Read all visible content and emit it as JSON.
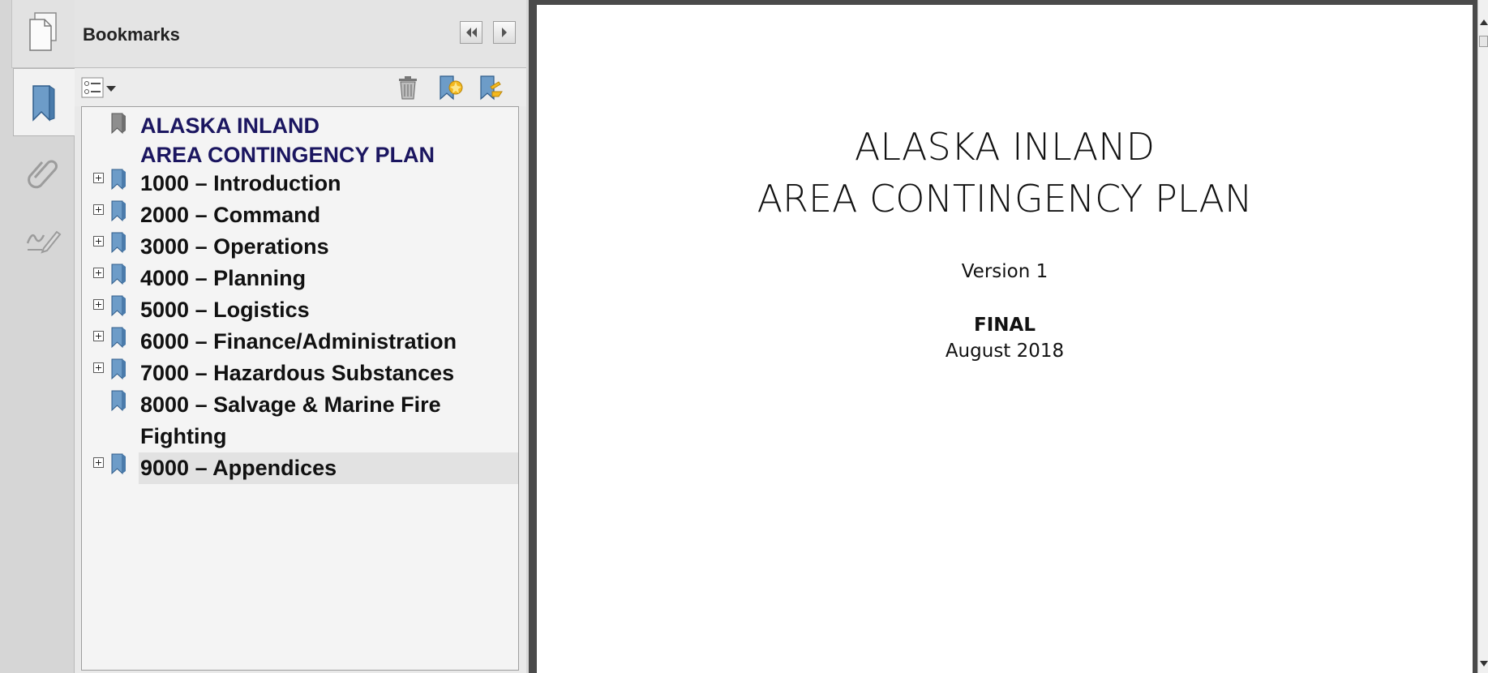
{
  "navigation_rail": {
    "items": [
      {
        "icon": "page-thumbnails-icon"
      },
      {
        "icon": "bookmark-icon",
        "active": true
      },
      {
        "icon": "paperclip-icon"
      },
      {
        "icon": "signature-icon"
      }
    ]
  },
  "bookmarks_panel": {
    "title": "Bookmarks",
    "header_buttons": [
      "collapse-panel-icon",
      "expand-panel-icon"
    ],
    "toolbar": [
      "options-menu-icon",
      "delete-bookmark-icon",
      "new-bookmark-icon",
      "bookmark-properties-icon"
    ],
    "items": [
      {
        "label_line1": "ALASKA INLAND",
        "label_line2": "AREA CONTINGENCY PLAN",
        "expandable": false,
        "root": true
      },
      {
        "label": "1000 – Introduction",
        "expandable": true
      },
      {
        "label": "2000 – Command",
        "expandable": true
      },
      {
        "label": "3000 – Operations",
        "expandable": true
      },
      {
        "label": "4000 – Planning",
        "expandable": true
      },
      {
        "label": "5000 – Logistics",
        "expandable": true
      },
      {
        "label": "6000 – Finance/Administration",
        "expandable": true
      },
      {
        "label": "7000 – Hazardous Substances",
        "expandable": true
      },
      {
        "label_line1": "8000 – Salvage & Marine Fire",
        "label_line2": "Fighting",
        "expandable": false
      },
      {
        "label": "9000 – Appendices",
        "expandable": true,
        "selected": true
      }
    ]
  },
  "document": {
    "title_line1": "ALASKA INLAND",
    "title_line2": "AREA CONTINGENCY PLAN",
    "version": "Version 1",
    "status": "FINAL",
    "date": "August 2018"
  },
  "colors": {
    "root_bookmark_text": "#1b1660",
    "bookmark_icon": "#6d9cc8",
    "document_background": "#4a4a4a"
  }
}
